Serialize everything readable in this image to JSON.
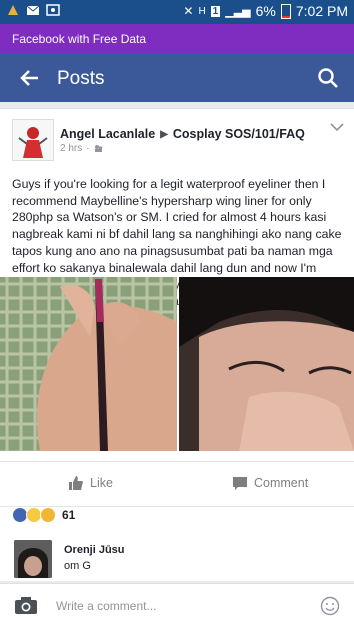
{
  "status_bar": {
    "battery": "6%",
    "time": "7:02 PM",
    "sim_badge": "1",
    "network": "H"
  },
  "free_data_banner": "Facebook with Free Data",
  "app_bar": {
    "title": "Posts"
  },
  "post": {
    "author": "Angel Lacanlale",
    "group": "Cosplay SOS/101/FAQ",
    "time": "2 hrs",
    "body": "Guys if you're looking for a legit waterproof eyeliner then I recommend Maybelline's hypersharp wing liner for only 280php sa Watson's or SM. I cried for almost 4 hours kasi nagbreak kami ni bf dahil lang sa nanghihingi ako nang cake tapos kung ano ano na pinagsusumbat pati ba naman mga effort ko sakanya binalewala dahil lang dun and now I'm crying again.. pero yun nga my cat eye is still there and maganda parin kahit wasak na puso ko.",
    "actions": {
      "like": "Like",
      "comment": "Comment"
    },
    "reactions_count": "61"
  },
  "comment": {
    "name": "Orenji Jūsu",
    "text": "om G"
  },
  "composer": {
    "placeholder": "Write a comment..."
  },
  "colors": {
    "facebook_blue": "#3b5998",
    "free_data_purple": "#7f2cc0",
    "statusbar": "#1a4f8b"
  }
}
